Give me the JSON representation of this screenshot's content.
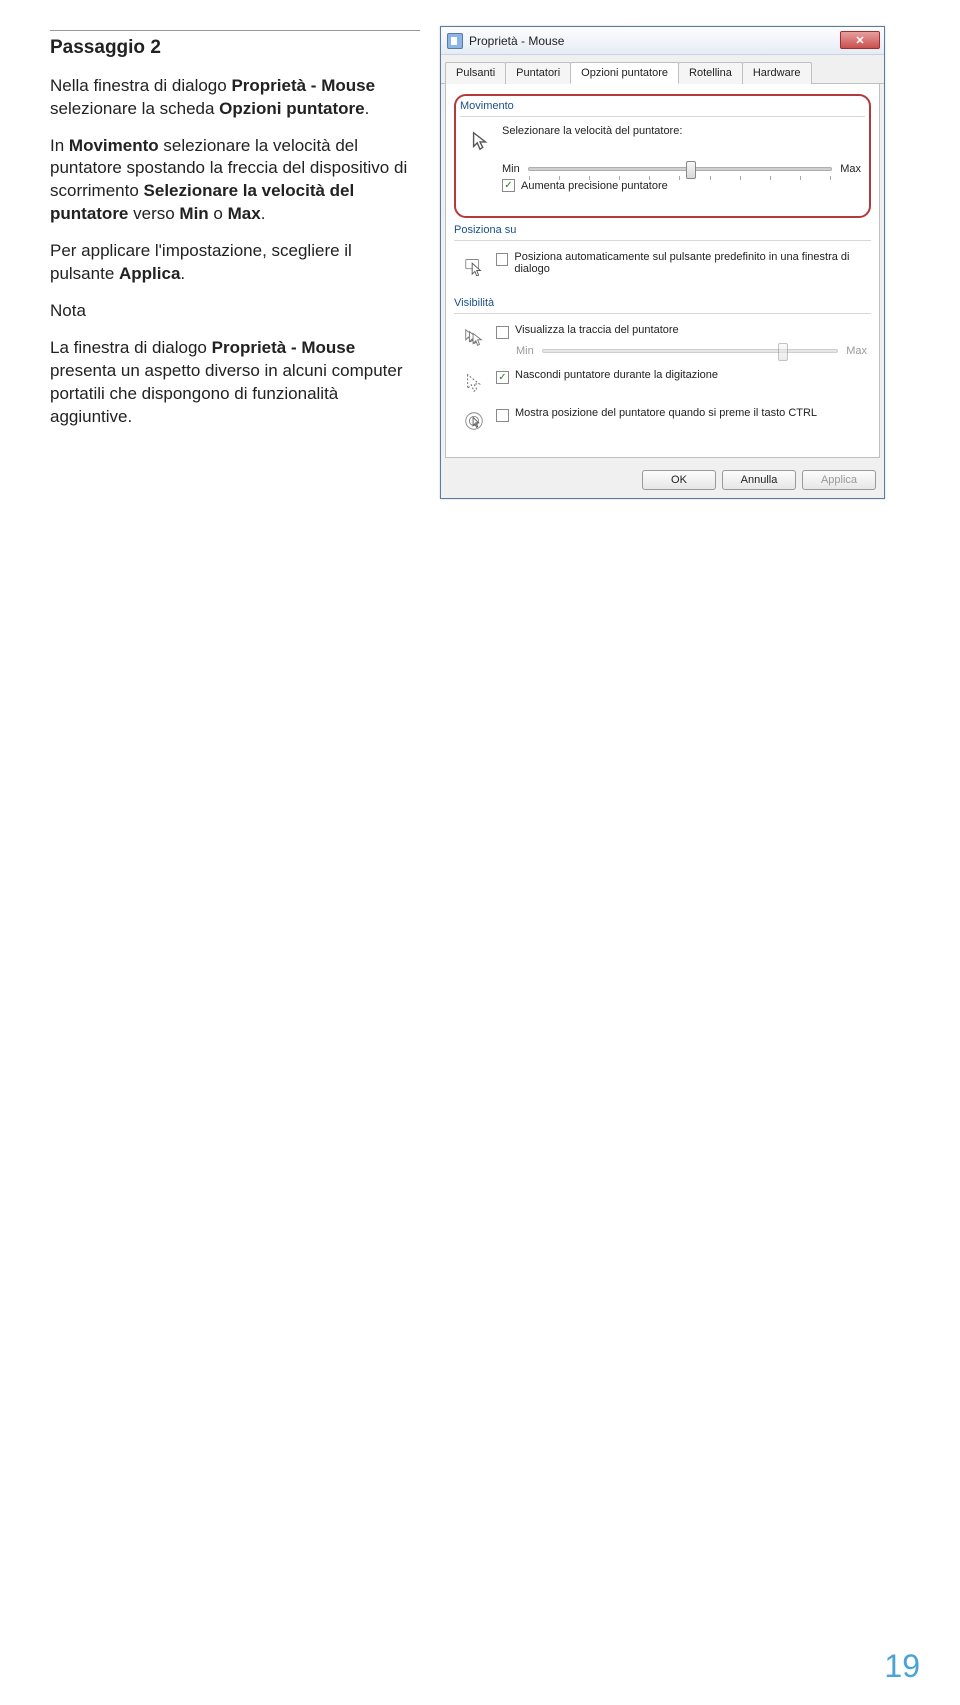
{
  "doc": {
    "step_title": "Passaggio 2",
    "p1_a": "Nella finestra di dialogo ",
    "p1_b": "Proprietà - Mouse",
    "p1_c": " selezionare la scheda ",
    "p1_d": "Opzioni puntatore",
    "p1_e": ".",
    "p2_a": "In ",
    "p2_b": "Movimento",
    "p2_c": " selezionare la velocità del puntatore spostando la freccia del dispositivo di scorrimento ",
    "p2_d": "Selezionare la velocità del puntatore",
    "p2_e": " verso ",
    "p2_f": "Min",
    "p2_g": " o ",
    "p2_h": "Max",
    "p2_i": ".",
    "p3_a": "Per applicare l'impostazione, scegliere il pulsante ",
    "p3_b": "Applica",
    "p3_c": ".",
    "note_label": "Nota",
    "p4_a": "La finestra di dialogo ",
    "p4_b": "Proprietà - Mouse",
    "p4_c": " presenta un aspetto diverso in alcuni computer portatili che dispongono di funzionalità aggiuntive.",
    "page_number": "19"
  },
  "dlg": {
    "title": "Proprietà - Mouse",
    "close": "✕",
    "tabs": {
      "t0": "Pulsanti",
      "t1": "Puntatori",
      "t2": "Opzioni puntatore",
      "t3": "Rotellina",
      "t4": "Hardware"
    },
    "grp_move": "Movimento",
    "speed_label": "Selezionare la velocità del puntatore:",
    "min": "Min",
    "max": "Max",
    "precision": "Aumenta precisione puntatore",
    "grp_snap": "Posiziona su",
    "snap_text": "Posiziona automaticamente sul pulsante predefinito in una finestra di dialogo",
    "grp_vis": "Visibilità",
    "trail": "Visualizza la traccia del puntatore",
    "trail_min": "Min",
    "trail_max": "Max",
    "hide": "Nascondi puntatore durante la digitazione",
    "ctrl": "Mostra posizione del puntatore quando si preme il tasto CTRL",
    "ok": "OK",
    "cancel": "Annulla",
    "apply": "Applica"
  }
}
